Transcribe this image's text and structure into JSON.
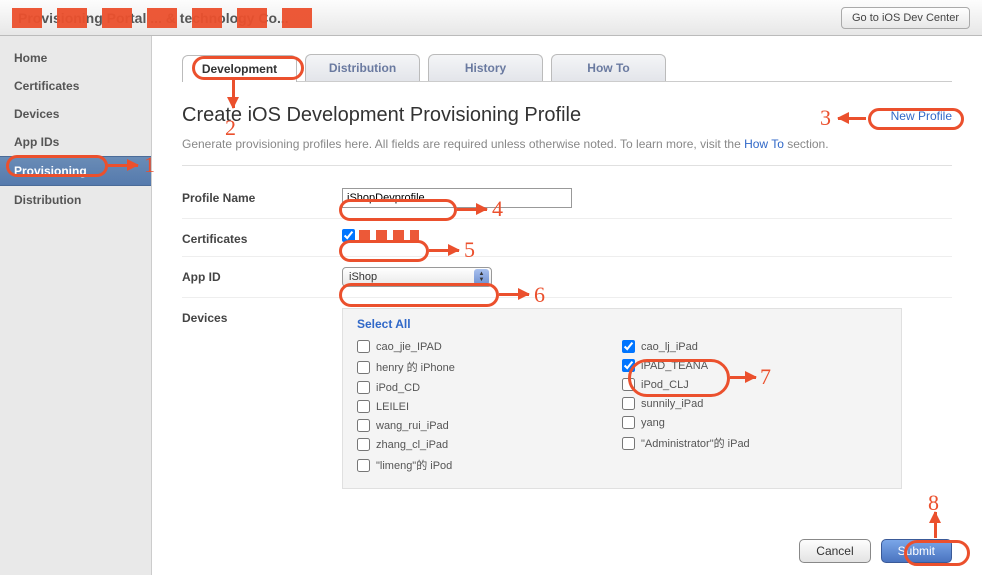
{
  "header": {
    "title_obscured": "Provisioning Portal ... & technology Co...",
    "dev_center_btn": "Go to iOS Dev Center"
  },
  "sidebar": {
    "items": [
      {
        "label": "Home",
        "selected": false
      },
      {
        "label": "Certificates",
        "selected": false
      },
      {
        "label": "Devices",
        "selected": false
      },
      {
        "label": "App IDs",
        "selected": false
      },
      {
        "label": "Provisioning",
        "selected": true
      },
      {
        "label": "Distribution",
        "selected": false
      }
    ]
  },
  "tabs": [
    {
      "label": "Development",
      "active": true
    },
    {
      "label": "Distribution",
      "active": false
    },
    {
      "label": "History",
      "active": false
    },
    {
      "label": "How To",
      "active": false
    }
  ],
  "page": {
    "title": "Create iOS Development Provisioning Profile",
    "new_profile": "New Profile",
    "desc_prefix": "Generate provisioning profiles here. All fields are required unless otherwise noted. To learn more, visit the ",
    "desc_link": "How To",
    "desc_suffix": " section."
  },
  "form": {
    "profile_name_label": "Profile Name",
    "profile_name_value": "iShopDevprofile",
    "certificates_label": "Certificates",
    "certificate_checked": true,
    "app_id_label": "App ID",
    "app_id_value": "iShop",
    "devices_label": "Devices",
    "select_all": "Select All",
    "devices_col1": [
      {
        "label": "cao_jie_IPAD",
        "checked": false
      },
      {
        "label": "henry 的 iPhone",
        "checked": false
      },
      {
        "label": "iPod_CD",
        "checked": false
      },
      {
        "label": "LEILEI",
        "checked": false
      },
      {
        "label": "wang_rui_iPad",
        "checked": false
      },
      {
        "label": "zhang_cl_iPad",
        "checked": false
      },
      {
        "label": "\"limeng\"的 iPod",
        "checked": false
      }
    ],
    "devices_col2": [
      {
        "label": "cao_lj_iPad",
        "checked": true
      },
      {
        "label": "iPAD_TEANA",
        "checked": true
      },
      {
        "label": "iPod_CLJ",
        "checked": false
      },
      {
        "label": "sunnily_iPad",
        "checked": false
      },
      {
        "label": "yang",
        "checked": false
      },
      {
        "label": "\"Administrator\"的 iPad",
        "checked": false
      }
    ]
  },
  "actions": {
    "cancel": "Cancel",
    "submit": "Submit"
  },
  "annotations": {
    "1": "1",
    "2": "2",
    "3": "3",
    "4": "4",
    "5": "5",
    "6": "6",
    "7": "7",
    "8": "8"
  }
}
